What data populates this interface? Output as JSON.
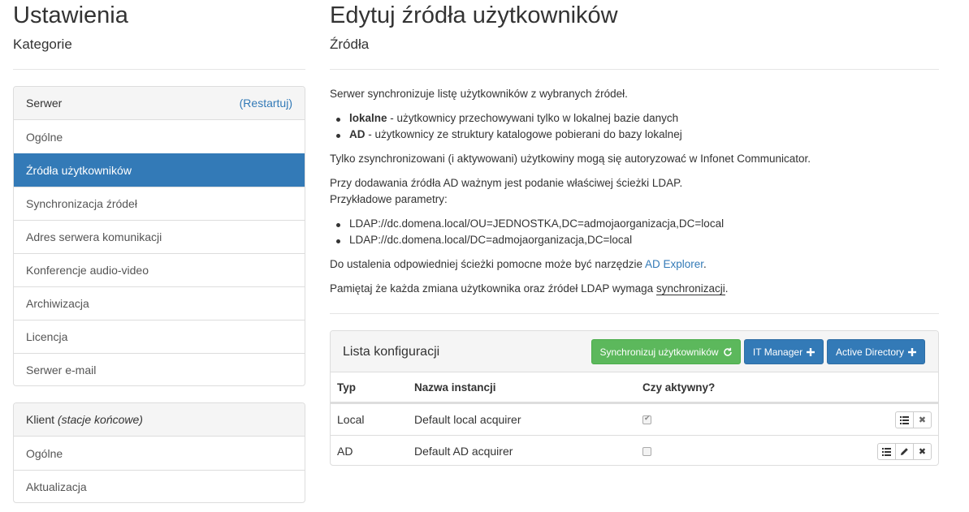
{
  "left": {
    "title": "Ustawienia",
    "subtitle": "Kategorie",
    "server_panel": {
      "heading": "Serwer",
      "restart_link": "(Restartuj)",
      "items": [
        {
          "label": "Ogólne"
        },
        {
          "label": "Źródła użytkowników",
          "active": true
        },
        {
          "label": "Synchronizacja źródeł"
        },
        {
          "label": "Adres serwera komunikacji"
        },
        {
          "label": "Konferencje audio-video"
        },
        {
          "label": "Archiwizacja"
        },
        {
          "label": "Licencja"
        },
        {
          "label": "Serwer e-mail"
        }
      ]
    },
    "client_panel": {
      "heading": "Klient",
      "heading_note": "(stacje końcowe)",
      "items": [
        {
          "label": "Ogólne"
        },
        {
          "label": "Aktualizacja"
        }
      ]
    }
  },
  "right": {
    "title": "Edytuj źródła użytkowników",
    "subtitle": "Źródła",
    "intro": "Serwer synchronizuje listę użytkowników z wybranych źródeł.",
    "bullets1": [
      {
        "bold": "lokalne",
        "text": " - użytkownicy przechowywani tylko w lokalnej bazie danych"
      },
      {
        "bold": "AD",
        "text": " - użytkownicy ze struktury katalogowe pobierani do bazy lokalnej"
      }
    ],
    "p2": "Tylko zsynchronizowani (i aktywowani) użytkowiny mogą się autoryzować w Infonet Communicator.",
    "p3a": "Przy dodawania źródła AD ważnym jest podanie właściwej ścieżki LDAP.",
    "p3b": "Przykładowe parametry:",
    "ldap_examples": [
      "LDAP://dc.domena.local/OU=JEDNOSTKA,DC=admojaorganizacja,DC=local",
      "LDAP://dc.domena.local/DC=admojaorganizacja,DC=local"
    ],
    "p4_prefix": "Do ustalenia odpowiedniej ścieżki pomocne może być narzędzie ",
    "p4_link": "AD Explorer",
    "p4_suffix": ".",
    "p5_prefix": "Pamiętaj że każda zmiana użytkownika oraz źródeł LDAP wymaga ",
    "p5_link": "synchronizacji",
    "p5_suffix": ".",
    "config": {
      "title": "Lista konfiguracji",
      "buttons": {
        "sync": "Synchronizuj użytkowników",
        "it_manager": "IT Manager",
        "active_directory": "Active Directory"
      },
      "columns": [
        "Typ",
        "Nazwa instancji",
        "Czy aktywny?"
      ],
      "rows": [
        {
          "type": "Local",
          "name": "Default local acquirer",
          "active": true
        },
        {
          "type": "AD",
          "name": "Default AD acquirer",
          "active": false
        }
      ]
    }
  }
}
